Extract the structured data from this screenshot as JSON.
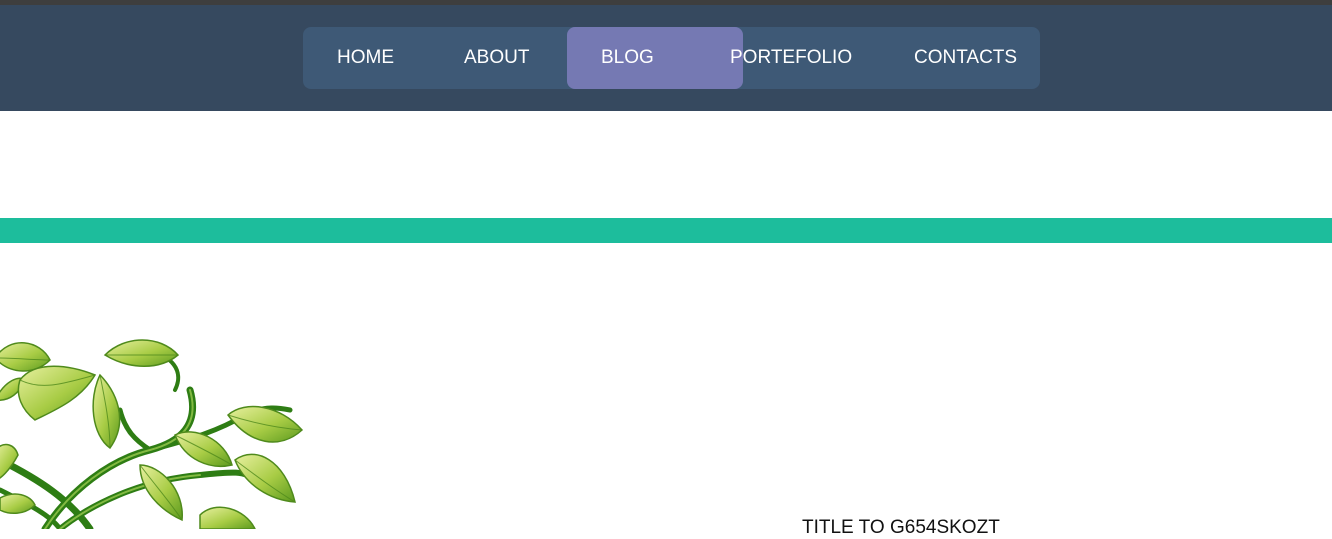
{
  "nav": {
    "items": [
      {
        "label": "HOME"
      },
      {
        "label": "ABOUT"
      },
      {
        "label": "BLOG"
      },
      {
        "label": "PORTEFOLIO"
      },
      {
        "label": "CONTACTS"
      }
    ],
    "active_index": 2
  },
  "colors": {
    "header_bg": "#36495f",
    "nav_bg": "#3e5976",
    "nav_active": "#7579b3",
    "accent_bar": "#1dbd9c"
  },
  "post": {
    "title": "TITLE TO G654SKOZT"
  },
  "illustration": {
    "icon": "green-vine-leaves-illustration"
  }
}
